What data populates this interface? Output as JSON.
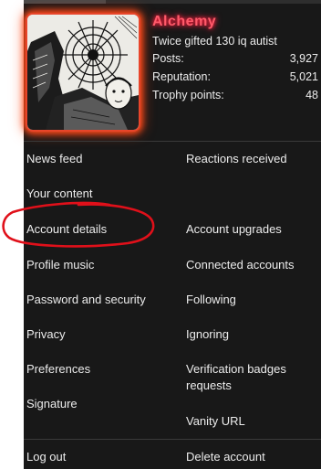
{
  "profile": {
    "username": "Alchemy",
    "title": "Twice gifted 130 iq autist",
    "stats": [
      {
        "label": "Posts:",
        "value": "3,927"
      },
      {
        "label": "Reputation:",
        "value": "5,021"
      },
      {
        "label": "Trophy points:",
        "value": "48"
      }
    ]
  },
  "menu": {
    "news_feed": "News feed",
    "reactions_received": "Reactions received",
    "your_content": "Your content",
    "account_details": "Account details",
    "account_upgrades": "Account upgrades",
    "profile_music": "Profile music",
    "connected_accounts": "Connected accounts",
    "password_security": "Password and security",
    "following": "Following",
    "privacy": "Privacy",
    "ignoring": "Ignoring",
    "preferences": "Preferences",
    "verification_badges": "Verification badges requests",
    "signature": "Signature",
    "vanity_url": "Vanity URL",
    "log_out": "Log out",
    "delete_account": "Delete account"
  },
  "colors": {
    "panel_bg": "#181818",
    "username": "#ff5a6a",
    "avatar_glow": "#ff4a1a",
    "annotation": "#e0101a"
  }
}
